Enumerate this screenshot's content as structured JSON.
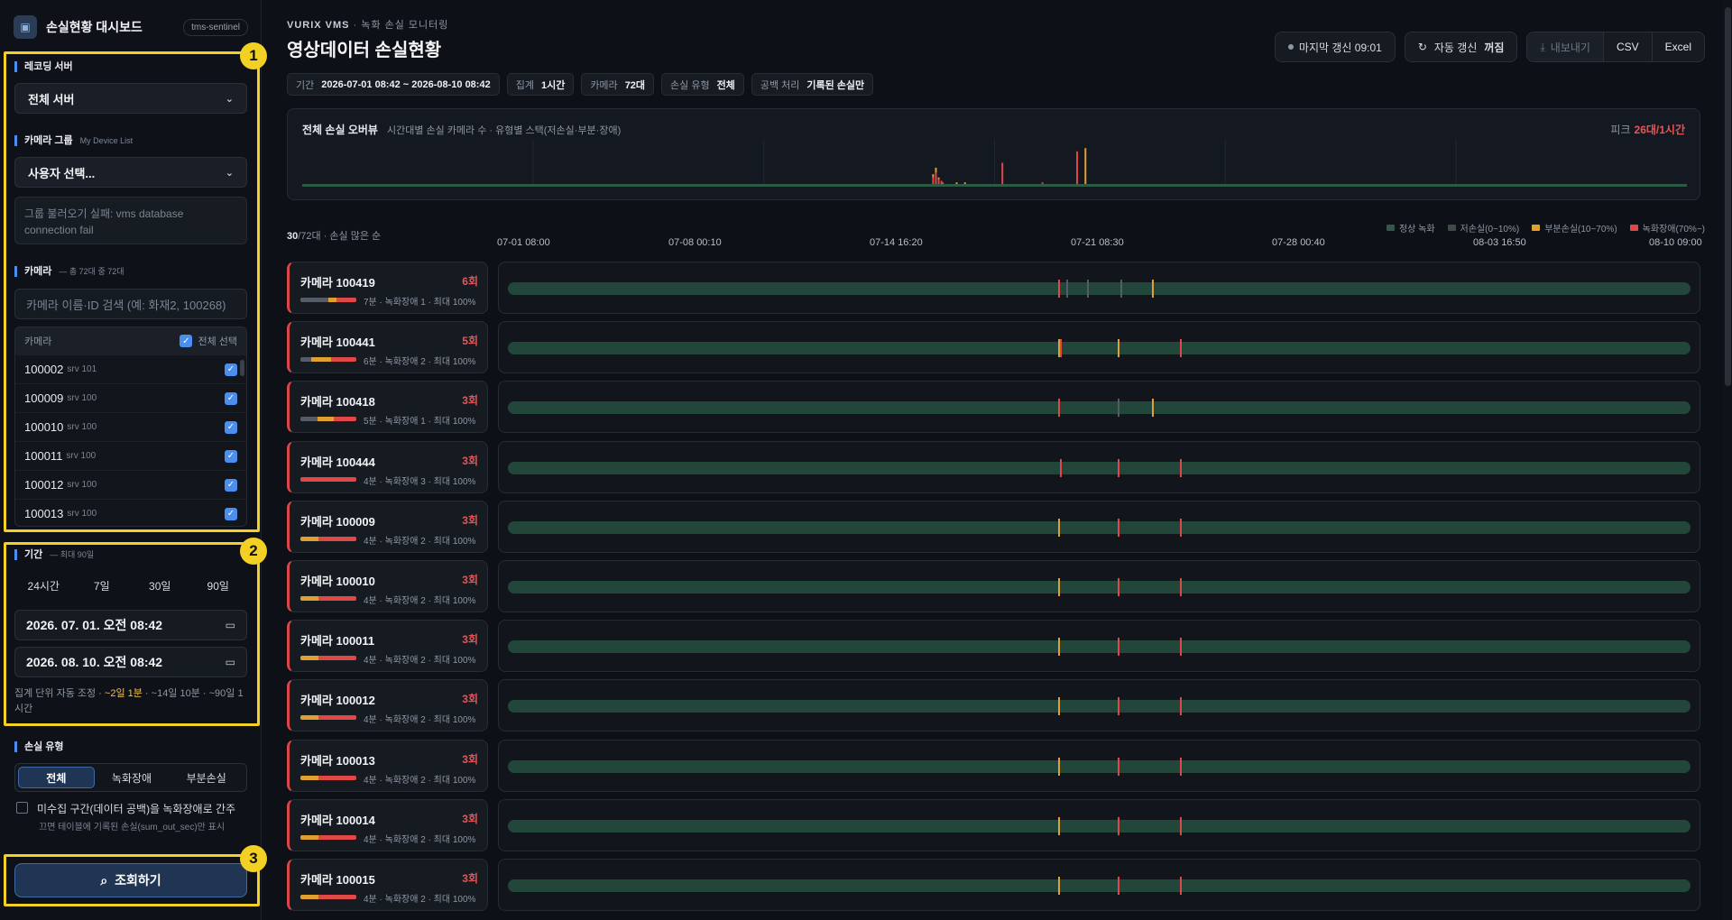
{
  "brand": {
    "title": "손실현황 대시보드",
    "tag": "tms-sentinel"
  },
  "sidebar": {
    "recording_server": {
      "title": "레코딩 서버",
      "value": "전체 서버"
    },
    "camera_group": {
      "title": "카메라 그룹",
      "sub": "My Device List",
      "value": "사용자 선택...",
      "error": "그룹 불러오기 실패: vms database connection fail"
    },
    "camera": {
      "title": "카메라",
      "sub": "— 총 72대 중 72대",
      "search_placeholder": "카메라 이름·ID 검색 (예: 화재2, 100268)",
      "col_camera": "카메라",
      "col_all": "전체 선택",
      "items": [
        {
          "id": "100002",
          "srv": "srv 101"
        },
        {
          "id": "100009",
          "srv": "srv 100"
        },
        {
          "id": "100010",
          "srv": "srv 100"
        },
        {
          "id": "100011",
          "srv": "srv 100"
        },
        {
          "id": "100012",
          "srv": "srv 100"
        },
        {
          "id": "100013",
          "srv": "srv 100"
        }
      ]
    },
    "period": {
      "title": "기간",
      "sub": "— 최대 90일",
      "presets": [
        "24시간",
        "7일",
        "30일",
        "90일"
      ],
      "start": "2026. 07. 01. 오전 08:42",
      "end": "2026. 08. 10. 오전 08:42",
      "agg_prefix": "집계 단위 자동 조정 · ",
      "agg_hi": "~2일 1분",
      "agg_rest": " · ~14일 10분 · ~90일 1시간"
    },
    "loss_type": {
      "title": "손실 유형",
      "options": [
        "전체",
        "녹화장애",
        "부분손실"
      ],
      "selected": "전체",
      "checkbox_label": "미수집 구간(데이터 공백)을 녹화장애로 간주",
      "checkbox_note": "끄면 테이블에 기록된 손실(sum_out_sec)만 표시"
    },
    "search_button": "조회하기",
    "badges": [
      "1",
      "2",
      "3"
    ]
  },
  "header": {
    "crumb_brand": "VURIX VMS",
    "crumb_rest": " · 녹화 손실 모니터링",
    "title": "영상데이터 손실현황",
    "last_refresh": "마지막 갱신 09:01",
    "auto_refresh_label": "자동 갱신",
    "auto_refresh_state": "꺼짐",
    "export_label": "내보내기",
    "csv": "CSV",
    "excel": "Excel",
    "chips": [
      {
        "label": "기간",
        "value": "2026-07-01 08:42 ~ 2026-08-10 08:42"
      },
      {
        "label": "집계",
        "value": "1시간"
      },
      {
        "label": "카메라",
        "value": "72대"
      },
      {
        "label": "손실 유형",
        "value": "전체"
      },
      {
        "label": "공백 처리",
        "value": "기록된 손실만"
      }
    ]
  },
  "overview": {
    "title": "전체 손실 오버뷰",
    "subtitle": "시간대별 손실 카메라 수 · 유형별 스택(저손실·부분·장애)",
    "peak_label": "피크",
    "peak_value": "26대/1시간"
  },
  "list": {
    "count": "30",
    "total": "/72대 · 손실 많은 순",
    "axis": [
      "07-01 08:00",
      "07-08 00:10",
      "07-14 16:20",
      "07-21 08:30",
      "07-28 00:40",
      "08-03 16:50",
      "08-10 09:00"
    ],
    "legend": [
      {
        "label": "정상 녹화",
        "color": "#2e5a47"
      },
      {
        "label": "저손실(0~10%)",
        "color": "#3d4a48"
      },
      {
        "label": "부분손실(10~70%)",
        "color": "#e0a030"
      },
      {
        "label": "녹화장애(70%~)",
        "color": "#e04848"
      }
    ],
    "cameras": [
      {
        "name": "카메라 100419",
        "count": "6회",
        "meta": "7분 · 녹화장애 1 · 최대 100%",
        "bar": [
          [
            0.5,
            "#555c66"
          ],
          [
            0.15,
            "#e0a030"
          ],
          [
            0.35,
            "#e04848"
          ]
        ],
        "marks": [
          [
            0.465,
            "#e04848"
          ],
          [
            0.472,
            "#555c66"
          ],
          [
            0.49,
            "#555c66"
          ],
          [
            0.518,
            "#555c66"
          ],
          [
            0.545,
            "#e0a030"
          ]
        ]
      },
      {
        "name": "카메라 100441",
        "count": "5회",
        "meta": "6분 · 녹화장애 2 · 최대 100%",
        "bar": [
          [
            0.2,
            "#555c66"
          ],
          [
            0.35,
            "#e0a030"
          ],
          [
            0.45,
            "#e04848"
          ]
        ],
        "marks": [
          [
            0.465,
            "#e0a030"
          ],
          [
            0.467,
            "#e04848"
          ],
          [
            0.516,
            "#e0a030"
          ],
          [
            0.568,
            "#e04848"
          ]
        ]
      },
      {
        "name": "카메라 100418",
        "count": "3회",
        "meta": "5분 · 녹화장애 1 · 최대 100%",
        "bar": [
          [
            0.3,
            "#555c66"
          ],
          [
            0.3,
            "#e0a030"
          ],
          [
            0.4,
            "#e04848"
          ]
        ],
        "marks": [
          [
            0.465,
            "#e04848"
          ],
          [
            0.516,
            "#555c66"
          ],
          [
            0.545,
            "#e0a030"
          ]
        ]
      },
      {
        "name": "카메라 100444",
        "count": "3회",
        "meta": "4분 · 녹화장애 3 · 최대 100%",
        "bar": [
          [
            1,
            "#e04848"
          ]
        ],
        "marks": [
          [
            0.467,
            "#e04848"
          ],
          [
            0.516,
            "#e04848"
          ],
          [
            0.568,
            "#e04848"
          ]
        ]
      },
      {
        "name": "카메라 100009",
        "count": "3회",
        "meta": "4분 · 녹화장애 2 · 최대 100%",
        "bar": [
          [
            0.33,
            "#e0a030"
          ],
          [
            0.67,
            "#e04848"
          ]
        ],
        "marks": [
          [
            0.465,
            "#e0a030"
          ],
          [
            0.516,
            "#e04848"
          ],
          [
            0.568,
            "#e04848"
          ]
        ]
      },
      {
        "name": "카메라 100010",
        "count": "3회",
        "meta": "4분 · 녹화장애 2 · 최대 100%",
        "bar": [
          [
            0.33,
            "#e0a030"
          ],
          [
            0.67,
            "#e04848"
          ]
        ],
        "marks": [
          [
            0.465,
            "#e0a030"
          ],
          [
            0.516,
            "#e04848"
          ],
          [
            0.568,
            "#e04848"
          ]
        ]
      },
      {
        "name": "카메라 100011",
        "count": "3회",
        "meta": "4분 · 녹화장애 2 · 최대 100%",
        "bar": [
          [
            0.33,
            "#e0a030"
          ],
          [
            0.67,
            "#e04848"
          ]
        ],
        "marks": [
          [
            0.465,
            "#e0a030"
          ],
          [
            0.516,
            "#e04848"
          ],
          [
            0.568,
            "#e04848"
          ]
        ]
      },
      {
        "name": "카메라 100012",
        "count": "3회",
        "meta": "4분 · 녹화장애 2 · 최대 100%",
        "bar": [
          [
            0.33,
            "#e0a030"
          ],
          [
            0.67,
            "#e04848"
          ]
        ],
        "marks": [
          [
            0.465,
            "#e0a030"
          ],
          [
            0.516,
            "#e04848"
          ],
          [
            0.568,
            "#e04848"
          ]
        ]
      },
      {
        "name": "카메라 100013",
        "count": "3회",
        "meta": "4분 · 녹화장애 2 · 최대 100%",
        "bar": [
          [
            0.33,
            "#e0a030"
          ],
          [
            0.67,
            "#e04848"
          ]
        ],
        "marks": [
          [
            0.465,
            "#e0a030"
          ],
          [
            0.516,
            "#e04848"
          ],
          [
            0.568,
            "#e04848"
          ]
        ]
      },
      {
        "name": "카메라 100014",
        "count": "3회",
        "meta": "4분 · 녹화장애 2 · 최대 100%",
        "bar": [
          [
            0.33,
            "#e0a030"
          ],
          [
            0.67,
            "#e04848"
          ]
        ],
        "marks": [
          [
            0.465,
            "#e0a030"
          ],
          [
            0.516,
            "#e04848"
          ],
          [
            0.568,
            "#e04848"
          ]
        ]
      },
      {
        "name": "카메라 100015",
        "count": "3회",
        "meta": "4분 · 녹화장애 2 · 최대 100%",
        "bar": [
          [
            0.33,
            "#e0a030"
          ],
          [
            0.67,
            "#e04848"
          ]
        ],
        "marks": [
          [
            0.465,
            "#e0a030"
          ],
          [
            0.516,
            "#e04848"
          ],
          [
            0.568,
            "#e04848"
          ]
        ]
      }
    ]
  },
  "chart_data": {
    "type": "bar",
    "title": "전체 손실 오버뷰",
    "ylabel": "",
    "xlabel": "",
    "x": [
      0.455,
      0.457,
      0.459,
      0.461,
      0.462,
      0.472,
      0.478,
      0.505,
      0.534,
      0.559,
      0.565
    ],
    "series": [
      {
        "name": "녹화장애(70%~)",
        "values": [
          4,
          7,
          3,
          2,
          1,
          0,
          0,
          13,
          1,
          20,
          0
        ],
        "color": "#e04848"
      },
      {
        "name": "부분손실(10~70%)",
        "values": [
          2,
          3,
          1,
          0,
          0,
          1,
          1,
          0,
          0,
          0,
          22
        ],
        "color": "#e0a030"
      }
    ],
    "peak": 26
  }
}
